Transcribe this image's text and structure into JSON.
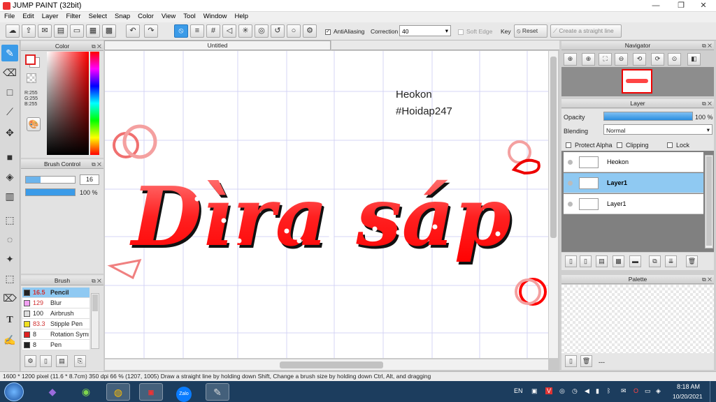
{
  "window": {
    "title": "JUMP PAINT (32bit)",
    "minimize": "—",
    "restore": "❐",
    "close": "✕"
  },
  "menu": [
    "File",
    "Edit",
    "Layer",
    "Filter",
    "Select",
    "Snap",
    "Color",
    "View",
    "Tool",
    "Window",
    "Help"
  ],
  "toolbar": {
    "antialiasing_label": "AntiAliasing",
    "correction_label": "Correction",
    "correction_value": "40",
    "soft_edge_label": "Soft Edge",
    "key_label": "Key",
    "reset_label": "Reset",
    "straight_line_label": "Create a straight line"
  },
  "color_panel": {
    "title": "Color",
    "r": "R:255",
    "g": "G:255",
    "b": "B:255",
    "foreground": "#e02020",
    "background": "#ffffff"
  },
  "brush_control": {
    "title": "Brush Control",
    "size_value": "16",
    "opacity_value": "100 %",
    "size_fill": 0.3,
    "opacity_fill": 1.0
  },
  "brush_panel": {
    "title": "Brush",
    "items": [
      {
        "size": "16.5",
        "name": "Pencil",
        "color": "#222222",
        "size_color": "#d03030"
      },
      {
        "size": "129",
        "name": "Blur",
        "color": "#f2a0f2",
        "size_color": "#d03030"
      },
      {
        "size": "100",
        "name": "Airbrush",
        "color": "#dddddd",
        "size_color": "#222222"
      },
      {
        "size": "83.3",
        "name": "Stipple Pen",
        "color": "#f0e020",
        "size_color": "#d03030"
      },
      {
        "size": "8",
        "name": "Rotation Symmetry",
        "color": "#e02020",
        "size_color": "#222222"
      },
      {
        "size": "8",
        "name": "Pen",
        "color": "#222222",
        "size_color": "#222222"
      }
    ]
  },
  "document": {
    "tab": "Untitled"
  },
  "canvas_text": {
    "line1": "Heokon",
    "line2": "#Hoidap247",
    "script": "Dìra sáp"
  },
  "navigator": {
    "title": "Navigator"
  },
  "layer_panel": {
    "title": "Layer",
    "opacity_label": "Opacity",
    "opacity_value": "100 %",
    "opacity_fill": 1.0,
    "blending_label": "Blending",
    "blending_value": "Normal",
    "protect_alpha": "Protect Alpha",
    "clipping": "Clipping",
    "lock": "Lock",
    "layers": [
      {
        "name": "Heokon",
        "selected": false
      },
      {
        "name": "Layer1",
        "selected": true
      },
      {
        "name": "Layer1",
        "selected": false
      }
    ]
  },
  "palette": {
    "title": "Palette",
    "more": "---"
  },
  "status": "1600 * 1200 pixel  (11.6 * 8.7cm)  350 dpi  66 %   (1207, 1005)   Draw a straight line by holding down Shift, Change a brush size by holding down Ctrl, Alt, and dragging",
  "taskbar": {
    "lang": "EN",
    "time": "8:18 AM",
    "date": "10/20/2021",
    "zalo": "Zalo"
  }
}
